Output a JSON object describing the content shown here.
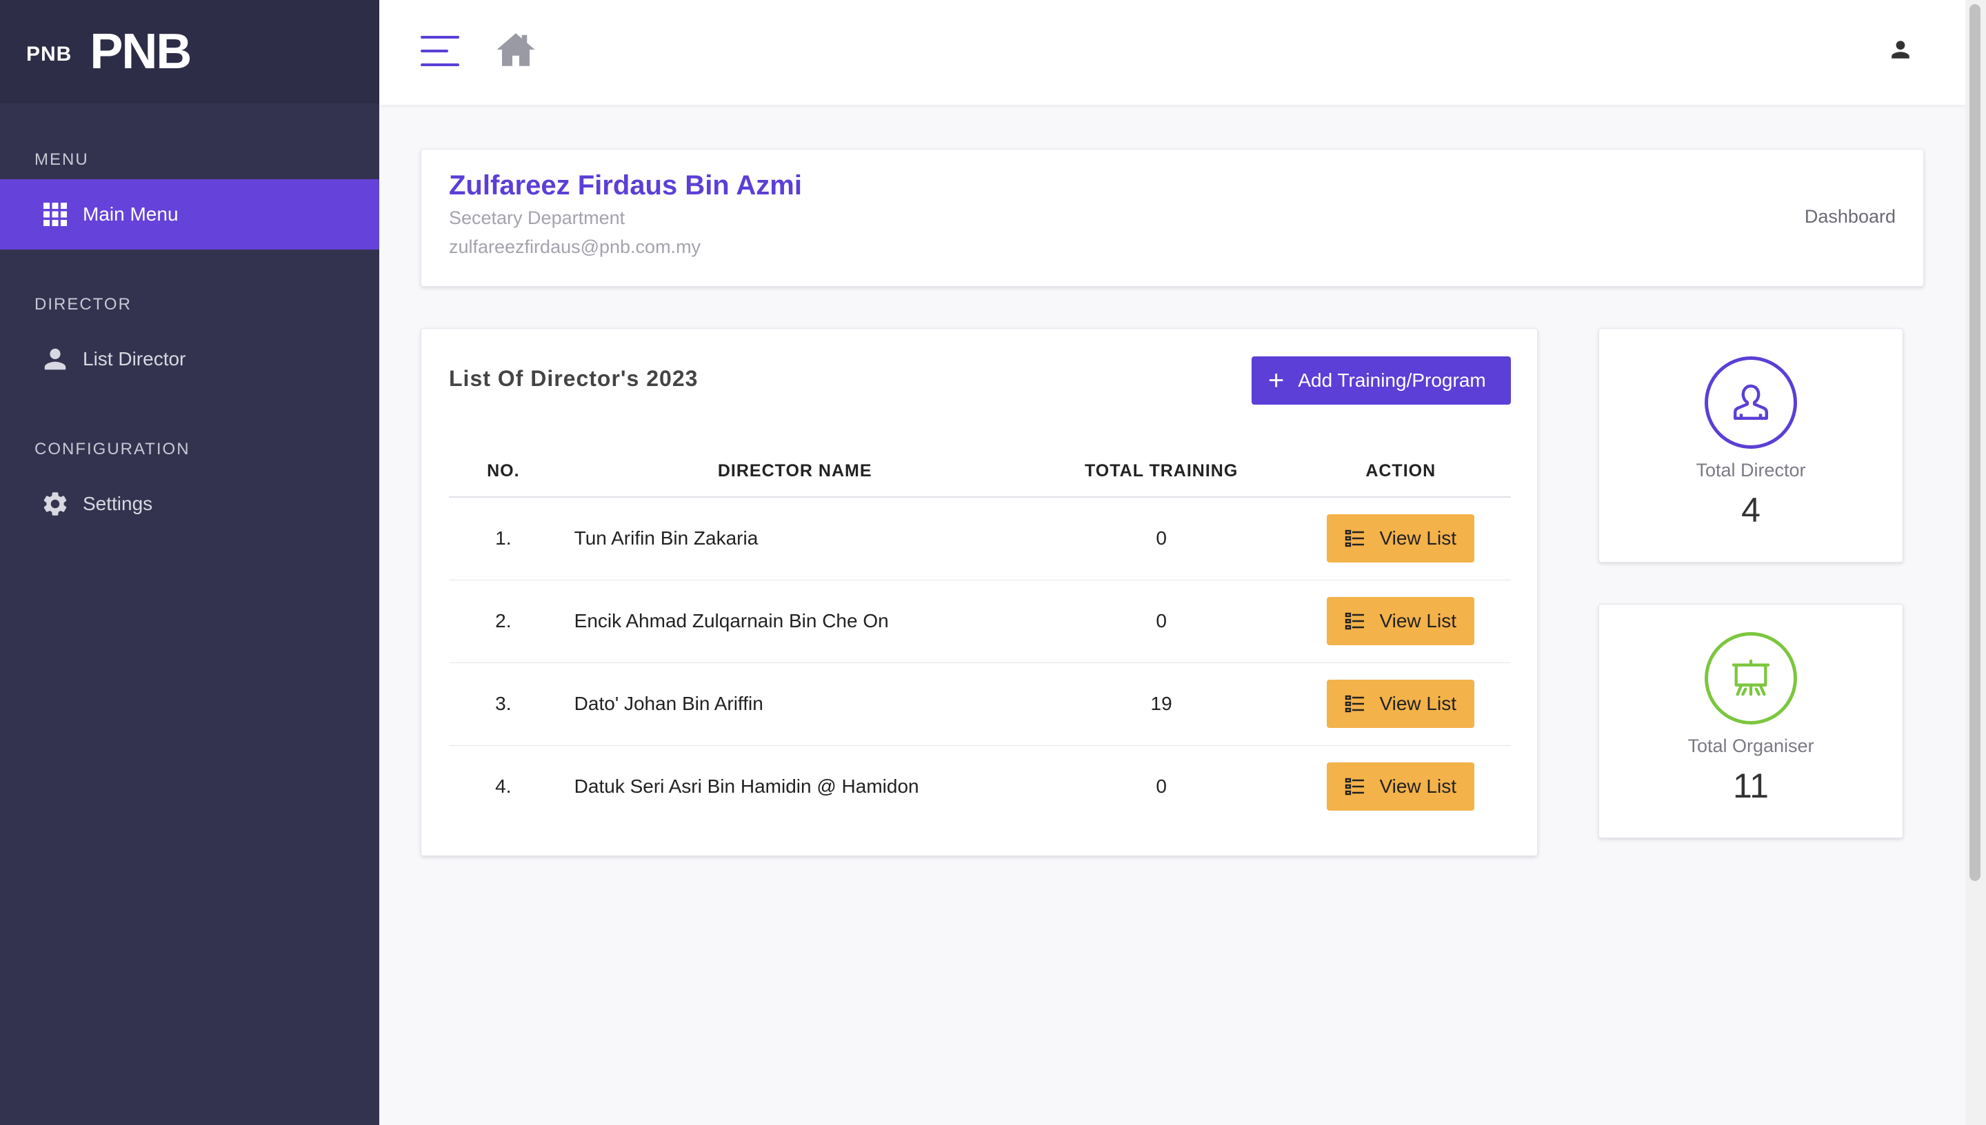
{
  "brand": {
    "small": "PNB",
    "big": "PNB"
  },
  "sidebar": {
    "sections": [
      {
        "title": "MENU",
        "items": [
          {
            "label": "Main Menu",
            "icon": "grid-icon",
            "active": true
          }
        ]
      },
      {
        "title": "DIRECTOR",
        "items": [
          {
            "label": "List Director",
            "icon": "person-icon",
            "active": false
          }
        ]
      },
      {
        "title": "CONFIGURATION",
        "items": [
          {
            "label": "Settings",
            "icon": "gear-icon",
            "active": false
          }
        ]
      }
    ]
  },
  "topbar": {
    "icons": [
      "hamburger-icon",
      "home-icon",
      "user-icon"
    ]
  },
  "profile": {
    "name": "Zulfareez Firdaus Bin Azmi",
    "department": "Secetary Department",
    "email": "zulfareezfirdaus@pnb.com.my",
    "breadcrumb": "Dashboard"
  },
  "director_list": {
    "title": "List Of Director's 2023",
    "add_button": "Add Training/Program",
    "columns": [
      "NO.",
      "DIRECTOR NAME",
      "TOTAL TRAINING",
      "ACTION"
    ],
    "rows": [
      {
        "no": "1.",
        "name": "Tun Arifin Bin Zakaria",
        "total": "0",
        "action": "View List"
      },
      {
        "no": "2.",
        "name": "Encik Ahmad Zulqarnain Bin Che On",
        "total": "0",
        "action": "View List"
      },
      {
        "no": "3.",
        "name": "Dato' Johan Bin Ariffin",
        "total": "19",
        "action": "View List"
      },
      {
        "no": "4.",
        "name": "Datuk Seri Asri Bin Hamidin @ Hamidon",
        "total": "0",
        "action": "View List"
      }
    ]
  },
  "stats": {
    "director": {
      "label": "Total Director",
      "value": "4",
      "icon": "user-outline-icon",
      "color": "#5b3fd6"
    },
    "organiser": {
      "label": "Total Organiser",
      "value": "11",
      "icon": "presentation-icon",
      "color": "#7cc63e"
    }
  },
  "colors": {
    "sidebar_bg": "#34334f",
    "accent": "#5b3fd6",
    "action_button": "#f4b24a"
  }
}
